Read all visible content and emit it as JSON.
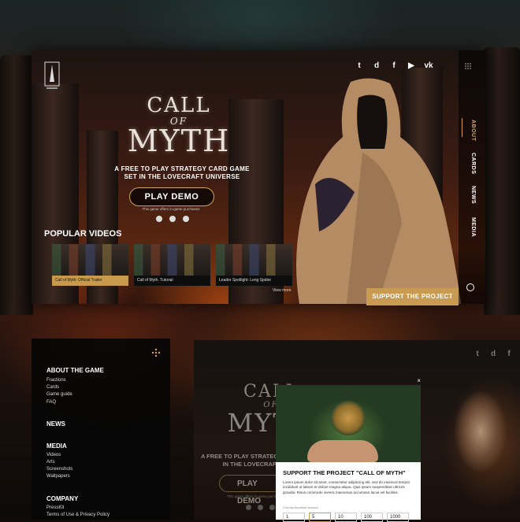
{
  "top": {
    "socials": [
      "t",
      "d",
      "f",
      "▶",
      "vk"
    ],
    "title": {
      "line1": "CALL",
      "line2": "OF",
      "line3": "MYTH"
    },
    "tagline": "A FREE TO PLAY STRATEGY CARD GAME SET IN THE LOVECRAFT UNIVERSE",
    "play_button": "PLAY DEMO",
    "purchase_note": "This game offers in-game purchases",
    "popular_videos": "POPULAR VIDEOS",
    "videos": [
      {
        "caption": "Call of Myth: Official Trailer"
      },
      {
        "caption": "Call of Myth. Tutorial"
      },
      {
        "caption": "Leader Spotlight: Leng Spider"
      }
    ],
    "view_more": "View more",
    "nav": [
      "ABOUT",
      "CARDS",
      "NEWS",
      "MEDIA"
    ],
    "support_button": "SUPPORT THE PROJECT"
  },
  "menu": {
    "sections": [
      {
        "title": "ABOUT THE GAME",
        "links": [
          "Fractions",
          "Cards",
          "Game guide",
          "FAQ"
        ]
      },
      {
        "title": "NEWS",
        "links": []
      },
      {
        "title": "MEDIA",
        "links": [
          "Videos",
          "Arts",
          "Screenshots",
          "Wallpapers"
        ]
      },
      {
        "title": "COMPANY",
        "links": [
          "PressKit",
          "Terms of Use & Privacy Policy"
        ]
      }
    ]
  },
  "bottom": {
    "socials": [
      "t",
      "d",
      "f"
    ],
    "title": {
      "line1": "CALL",
      "line2": "OF",
      "line3": "MYTH"
    },
    "tagline": "A FREE TO PLAY STRATEGY CARD GAME SET IN THE LOVECRAFT UNIVERSE",
    "play_button": "PLAY DEMO",
    "purchase_note": "This game offers in-game purchases"
  },
  "modal": {
    "close": "×",
    "title": "SUPPORT THE PROJECT \"CALL OF MYTH\"",
    "text": "Lorem ipsum dolor sit amet, consectetur adipiscing elit, sed do eiusmod tempor incididunt ut labore et dolore magna aliqua. Quis ipsum suspendisse ultrices gravida. Risus commodo viverra maecenas accumsan lacus vel facilisis.",
    "amount_label": "Choose donation amount",
    "amounts": [
      "1",
      "5",
      "10",
      "100",
      "1000"
    ]
  },
  "colors": {
    "accent": "#c99a52",
    "nav_active": "#d7a24b"
  }
}
